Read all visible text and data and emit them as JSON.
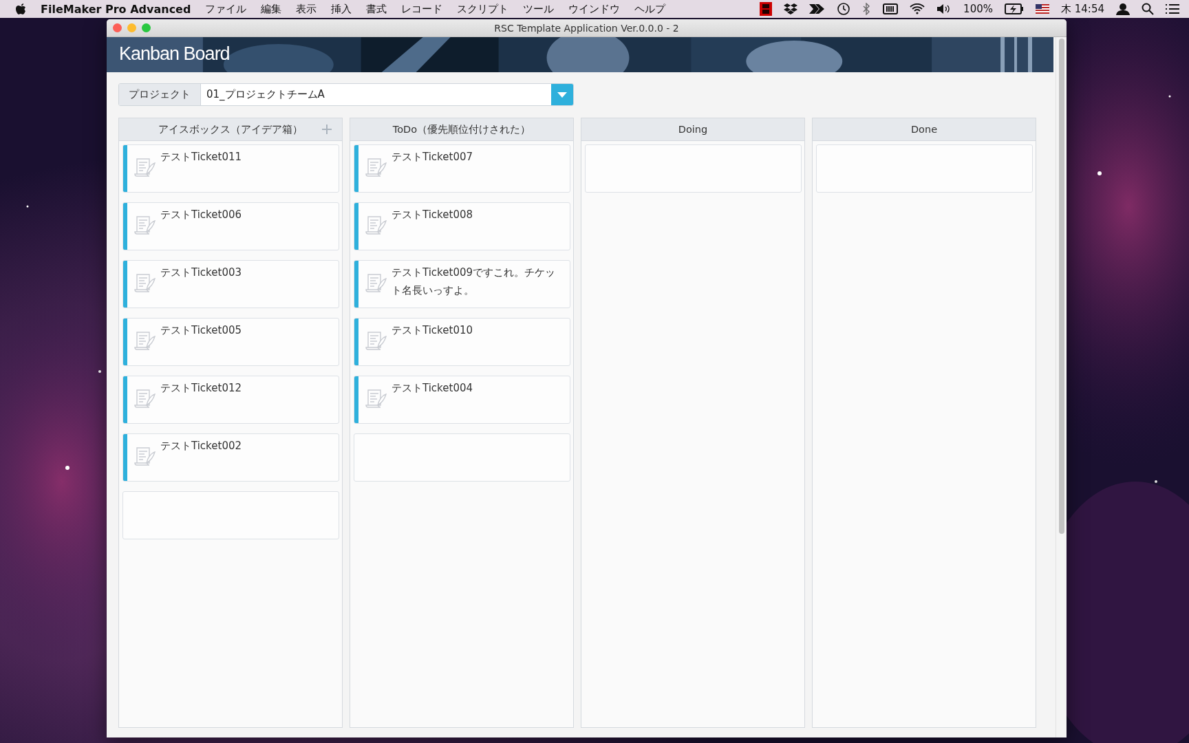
{
  "menu_bar": {
    "app_name": "FileMaker Pro Advanced",
    "menus": [
      "ファイル",
      "編集",
      "表示",
      "挿入",
      "書式",
      "レコード",
      "スクリプト",
      "ツール",
      "ウインドウ",
      "ヘルプ"
    ],
    "battery": "100%",
    "clock": "木 14:54"
  },
  "window": {
    "title": "RSC Template Application Ver.0.0.0 - 2",
    "banner_title": "Kanban Board"
  },
  "project": {
    "label": "プロジェクト",
    "value": "01_プロジェクトチームA"
  },
  "columns": [
    {
      "title": "アイスボックス（アイデア箱）",
      "add_button": true,
      "cards": [
        {
          "kind": "ticket",
          "title": "テストTicket011"
        },
        {
          "kind": "ticket",
          "title": "テストTicket006"
        },
        {
          "kind": "ticket",
          "title": "テストTicket003"
        },
        {
          "kind": "ticket",
          "title": "テストTicket005"
        },
        {
          "kind": "ticket",
          "title": "テストTicket012"
        },
        {
          "kind": "ticket",
          "title": "テストTicket002"
        },
        {
          "kind": "empty"
        }
      ]
    },
    {
      "title": "ToDo（優先順位付けされた）",
      "add_button": false,
      "cards": [
        {
          "kind": "ticket",
          "title": "テストTicket007"
        },
        {
          "kind": "ticket",
          "title": "テストTicket008"
        },
        {
          "kind": "ticket",
          "title": "テストTicket009ですこれ。チケット名長いっすよ。"
        },
        {
          "kind": "ticket",
          "title": "テストTicket010"
        },
        {
          "kind": "ticket",
          "title": "テストTicket004"
        },
        {
          "kind": "empty"
        }
      ]
    },
    {
      "title": "Doing",
      "add_button": false,
      "cards": [
        {
          "kind": "empty"
        }
      ]
    },
    {
      "title": "Done",
      "add_button": false,
      "cards": [
        {
          "kind": "empty"
        }
      ]
    }
  ]
}
